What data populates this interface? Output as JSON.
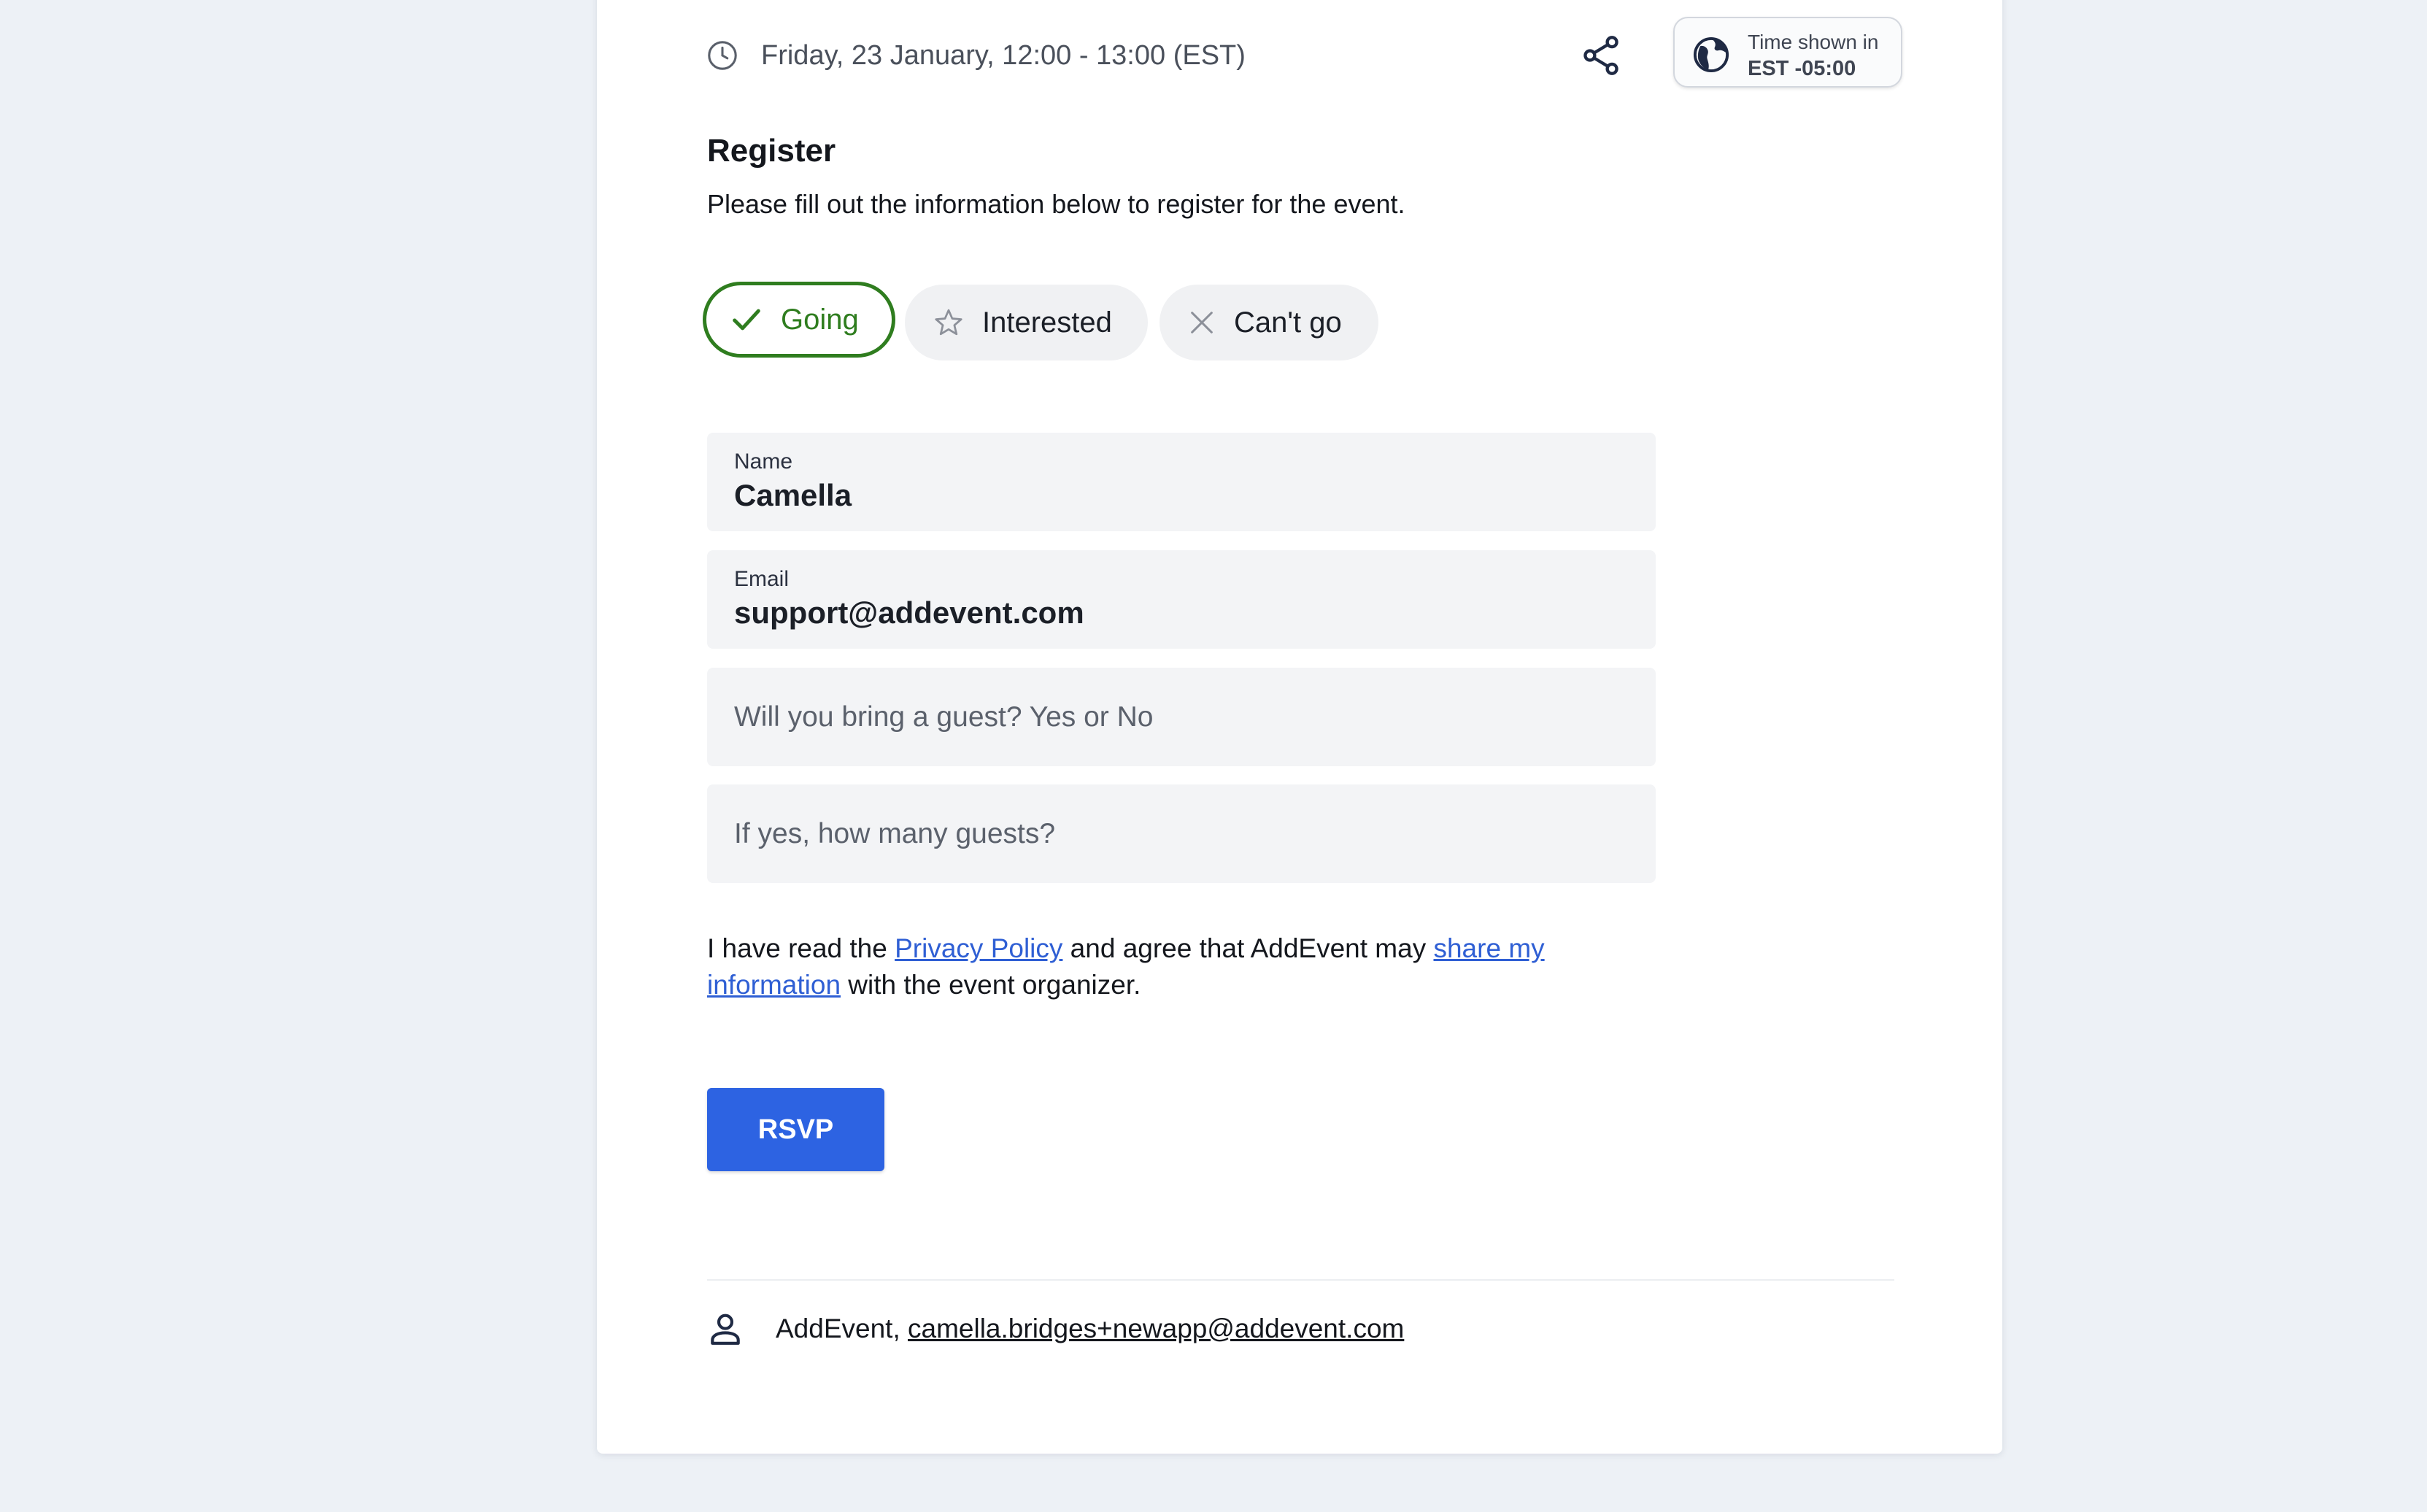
{
  "event": {
    "date_time": "Friday, 23 January, 12:00 - 13:00 (EST)",
    "timezone_label": "Time shown in",
    "timezone_value": "EST -05:00"
  },
  "register": {
    "title": "Register",
    "subtitle": "Please fill out the information below to register for the event."
  },
  "rsvp_options": {
    "going": "Going",
    "interested": "Interested",
    "cant_go": "Can't go",
    "selected": "going"
  },
  "form": {
    "name_label": "Name",
    "name_value": "Camella",
    "email_label": "Email",
    "email_value": "support@addevent.com",
    "guest_placeholder": "Will you bring a guest? Yes or No",
    "guest_count_placeholder": "If yes, how many guests?"
  },
  "consent": {
    "part1": "I have read the ",
    "privacy_link": "Privacy Policy",
    "part2": " and agree that AddEvent may ",
    "share_link": "share my information",
    "part3": " with the event organizer."
  },
  "submit_label": "RSVP",
  "organizer": {
    "name": "AddEvent, ",
    "email": "camella.bridges+newapp@addevent.com"
  },
  "colors": {
    "going_green": "#2f7d1f",
    "primary_blue": "#2d63e2",
    "link_blue": "#2f5fd4",
    "icon_navy": "#1f2a44"
  }
}
